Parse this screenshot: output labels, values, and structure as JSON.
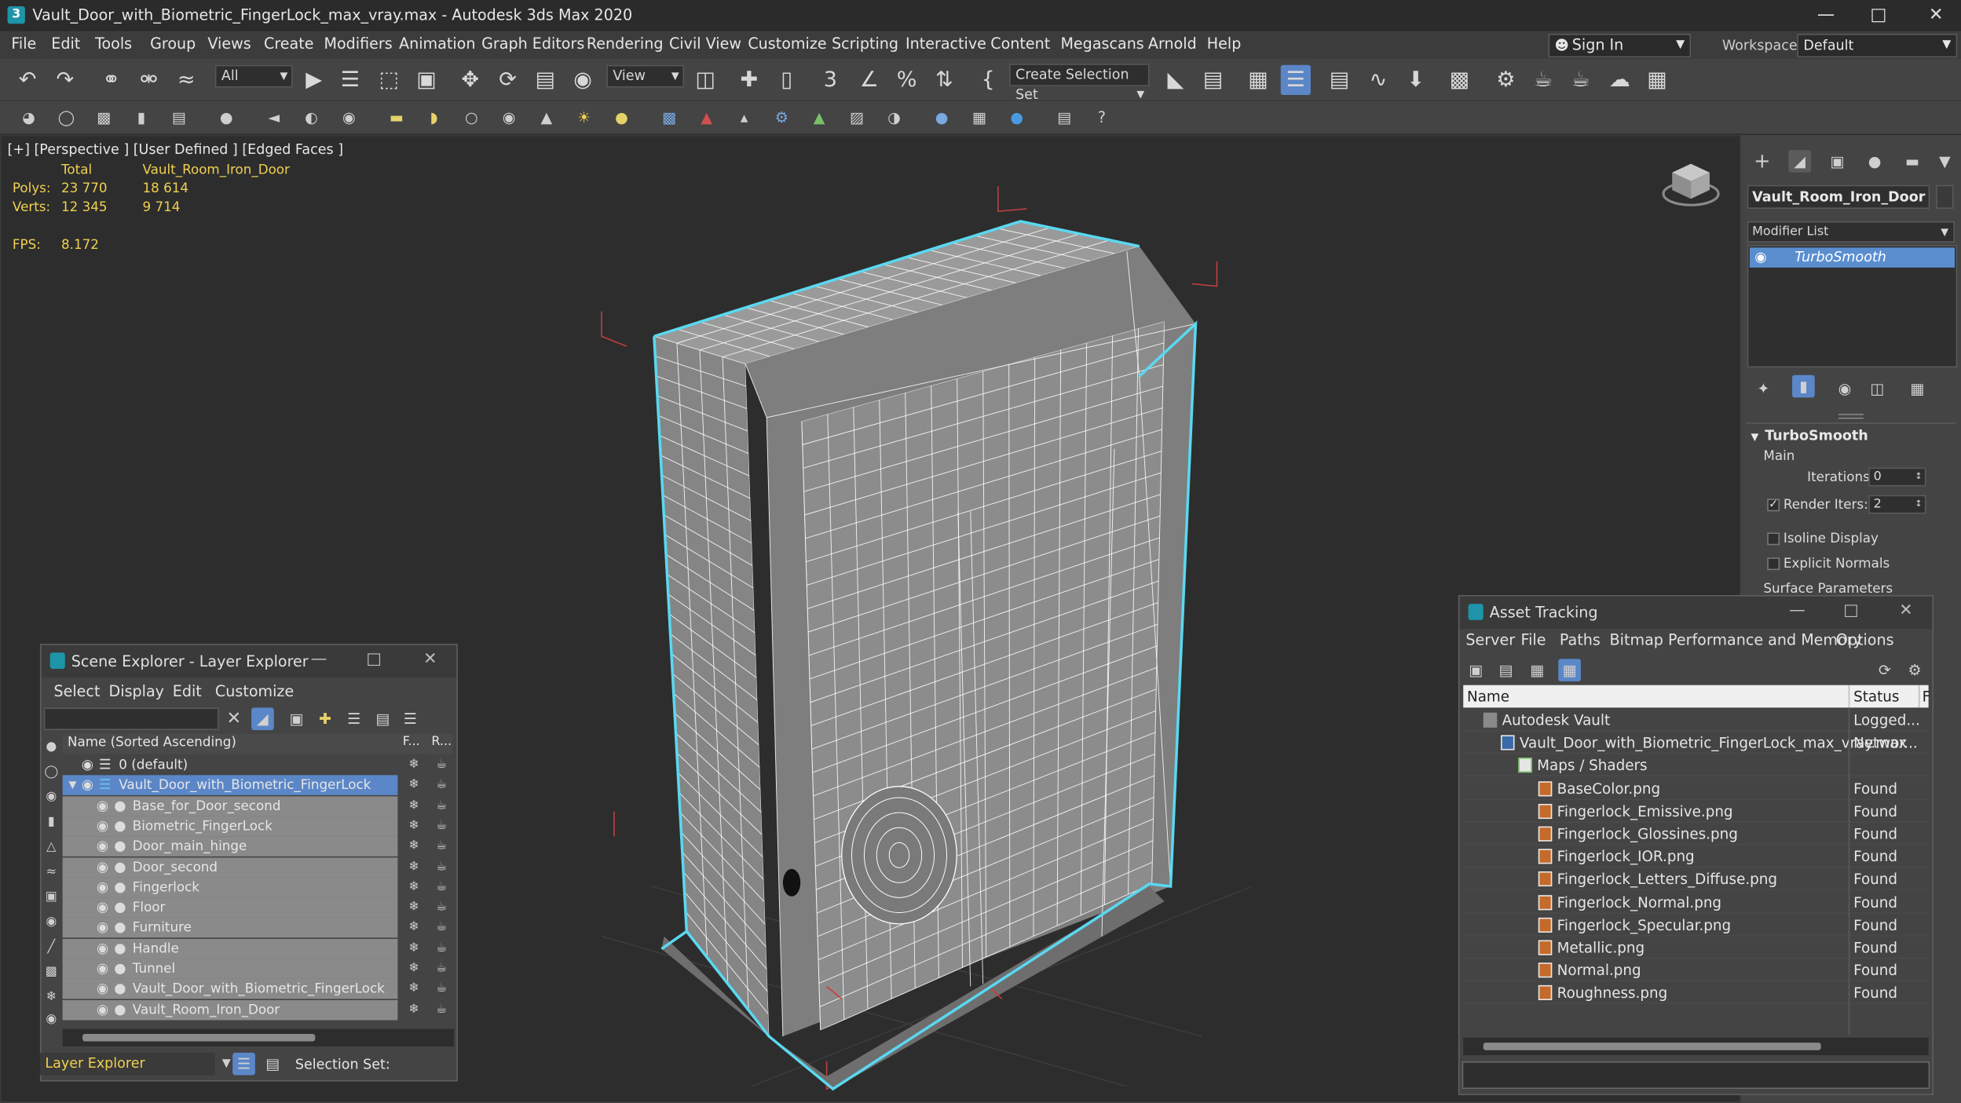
{
  "window": {
    "title": "Vault_Door_with_Biometric_FingerLock_max_vray.max - Autodesk 3ds Max 2020",
    "min_icon": "minimize-icon",
    "max_icon": "maximize-icon",
    "close_icon": "close-icon"
  },
  "menu": [
    "File",
    "Edit",
    "Tools",
    "Group",
    "Views",
    "Create",
    "Modifiers",
    "Animation",
    "Graph Editors",
    "Rendering",
    "Civil View",
    "Customize",
    "Scripting",
    "Interactive",
    "Content",
    "Megascans",
    "Arnold",
    "Help"
  ],
  "signin": {
    "label": "Sign In"
  },
  "workspaces": {
    "label": "Workspaces:",
    "value": "Default"
  },
  "toolbar": {
    "filter_value": "All",
    "refcoord_value": "View",
    "selection_set_placeholder": "Create Selection Set"
  },
  "viewport": {
    "label": "[+] [Perspective ] [User Defined ] [Edged Faces ]",
    "stats": {
      "header_total": "Total",
      "header_object": "Vault_Room_Iron_Door",
      "polys_label": "Polys:",
      "polys_total": "23 770",
      "polys_object": "18 614",
      "verts_label": "Verts:",
      "verts_total": "12 345",
      "verts_object": "9 714",
      "fps_label": "FPS:",
      "fps_value": "8.172"
    },
    "wire_color": "#ffffff",
    "selection_color": "#5ad8f0",
    "mesh_color": "#8a8a8a"
  },
  "command_panel": {
    "object_name": "Vault_Room_Iron_Door",
    "modifier_list_label": "Modifier List",
    "stack": [
      "TurboSmooth"
    ],
    "rollout_title": "TurboSmooth",
    "section_main": "Main",
    "iterations_label": "Iterations:",
    "iterations_value": "0",
    "render_iters_label": "Render Iters:",
    "render_iters_value": "2",
    "render_iters_checked": true,
    "isoline_label": "Isoline Display",
    "explicit_normals_label": "Explicit Normals",
    "surface_params_label": "Surface Parameters"
  },
  "scene_explorer": {
    "title": "Scene Explorer - Layer Explorer",
    "menu": [
      "Select",
      "Display",
      "Edit",
      "Customize"
    ],
    "col_name": "Name (Sorted Ascending)",
    "col_f": "F...",
    "col_r": "R...",
    "rows": [
      {
        "name": "0 (default)",
        "level": 0
      },
      {
        "name": "Vault_Door_with_Biometric_FingerLock",
        "level": 0
      },
      {
        "name": "Base_for_Door_second",
        "level": 1
      },
      {
        "name": "Biometric_FingerLock",
        "level": 1
      },
      {
        "name": "Door_main_hinge",
        "level": 1
      },
      {
        "name": "Door_second",
        "level": 1
      },
      {
        "name": "Fingerlock",
        "level": 1
      },
      {
        "name": "Floor",
        "level": 1
      },
      {
        "name": "Furniture",
        "level": 1
      },
      {
        "name": "Handle",
        "level": 1
      },
      {
        "name": "Tunnel",
        "level": 1
      },
      {
        "name": "Vault_Door_with_Biometric_FingerLock",
        "level": 1
      },
      {
        "name": "Vault_Room_Iron_Door",
        "level": 1
      }
    ],
    "footer_layer": "Layer Explorer",
    "footer_selset": "Selection Set:"
  },
  "asset_tracking": {
    "title": "Asset Tracking",
    "menu": [
      "Server",
      "File",
      "Paths",
      "Bitmap Performance and Memory",
      "Options"
    ],
    "col_name": "Name",
    "col_status": "Status",
    "col_extra": "F",
    "rows": [
      {
        "name": "Autodesk Vault",
        "status": "Logged...",
        "level": 0
      },
      {
        "name": "Vault_Door_with_Biometric_FingerLock_max_vray.max",
        "status": "Networ...",
        "level": 1
      },
      {
        "name": "Maps / Shaders",
        "status": "",
        "level": 2
      },
      {
        "name": "BaseColor.png",
        "status": "Found",
        "level": 3
      },
      {
        "name": "Fingerlock_Emissive.png",
        "status": "Found",
        "level": 3
      },
      {
        "name": "Fingerlock_Glossines.png",
        "status": "Found",
        "level": 3
      },
      {
        "name": "Fingerlock_IOR.png",
        "status": "Found",
        "level": 3
      },
      {
        "name": "Fingerlock_Letters_Diffuse.png",
        "status": "Found",
        "level": 3
      },
      {
        "name": "Fingerlock_Normal.png",
        "status": "Found",
        "level": 3
      },
      {
        "name": "Fingerlock_Specular.png",
        "status": "Found",
        "level": 3
      },
      {
        "name": "Metallic.png",
        "status": "Found",
        "level": 3
      },
      {
        "name": "Normal.png",
        "status": "Found",
        "level": 3
      },
      {
        "name": "Roughness.png",
        "status": "Found",
        "level": 3
      }
    ]
  }
}
